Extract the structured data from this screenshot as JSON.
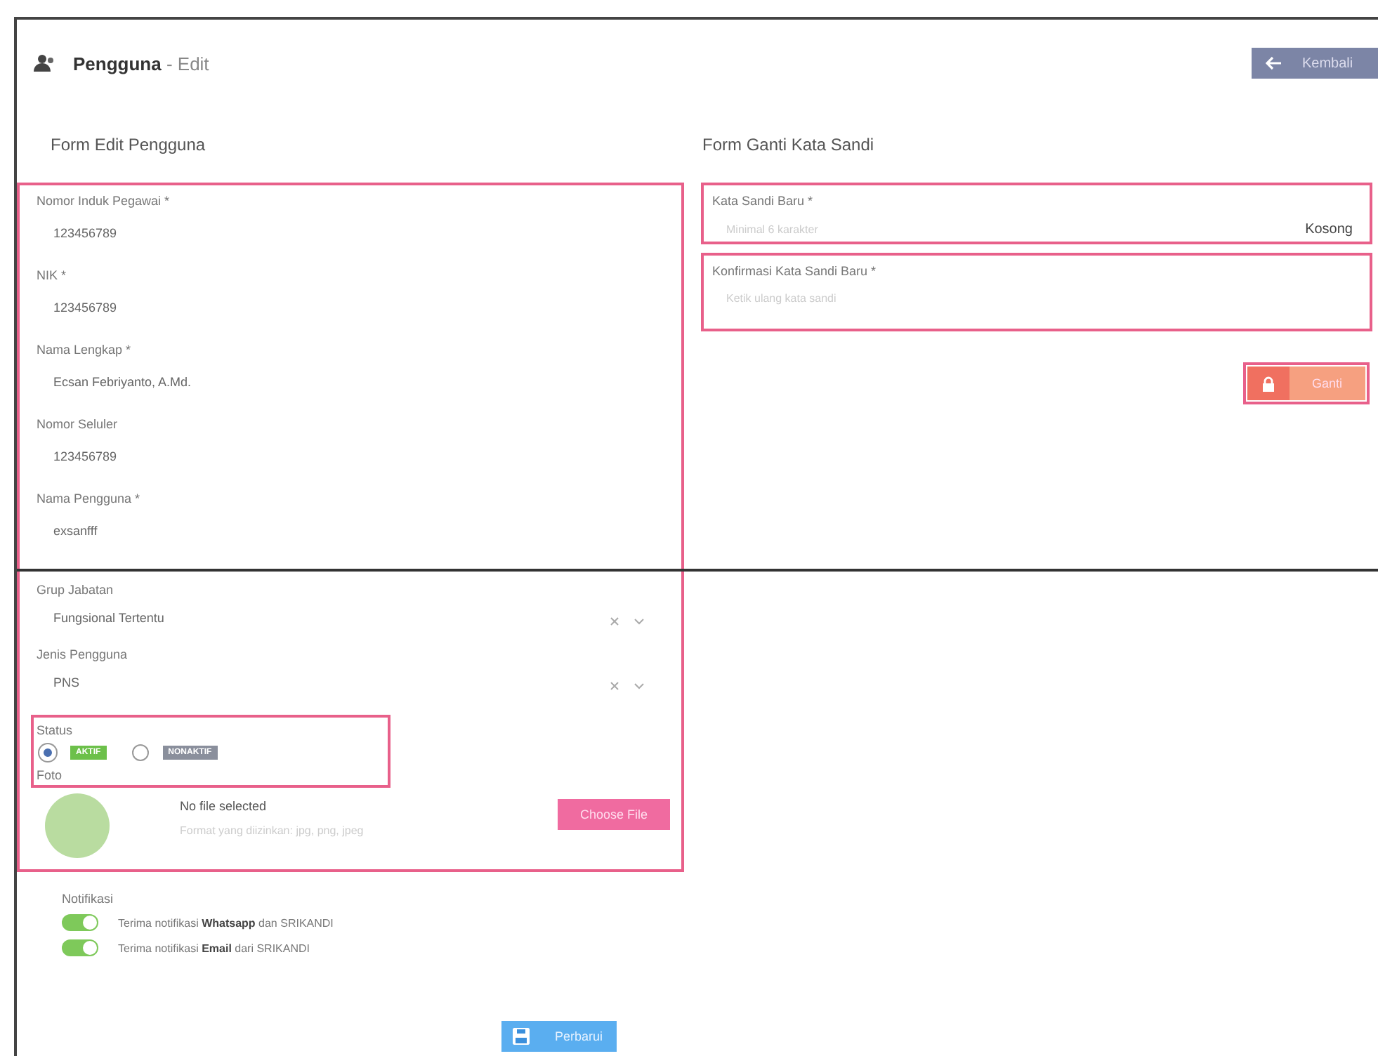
{
  "header": {
    "title": "**Pengguna** - Edit",
    "back_button": "Kembali"
  },
  "edit_form": {
    "title": "Form Edit Pengguna",
    "identity": {
      "highlighted": true,
      "fields": [
        {
          "label": "Nomor Induk Pegawai *",
          "value": "123456789",
          "kind": "text"
        },
        {
          "label": "NIK *",
          "value": "123456789",
          "kind": "text"
        },
        {
          "label": "Nama Lengkap *",
          "value": "Ecsan Febriyanto, A.Md.",
          "kind": "text"
        },
        {
          "label": "Nomor Seluler",
          "value": "123456789",
          "kind": "text"
        },
        {
          "label": "Nama Pengguna *",
          "value": "exsanfff",
          "kind": "text"
        }
      ]
    },
    "details": {
      "highlighted": true,
      "fields": [
        {
          "label": "Grup Jabatan",
          "value": "Fungsional Tertentu",
          "kind": "select"
        },
        {
          "label": "Jenis Pengguna",
          "value": "PNS",
          "kind": "select"
        }
      ],
      "status": {
        "label": "Status",
        "highlighted": true,
        "options": [
          {
            "label": "AKTIF",
            "selected": true,
            "color": "#6cc04a"
          },
          {
            "label": "NONAKTIF",
            "selected": false,
            "color": "#8a8f9c"
          }
        ]
      },
      "photo": {
        "label": "Foto",
        "file_text": "No file selected",
        "hint": "Format yang diizinkan: jpg, png, jpeg",
        "button": "Choose File"
      }
    },
    "notifications": {
      "label": "Notifikasi",
      "items": [
        {
          "text": "Terima notifikasi **Whatsapp** dan SRIKANDI",
          "on": true
        },
        {
          "text": "Terima notifikasi **Email** dari SRIKANDI",
          "on": true
        }
      ]
    },
    "save_button": "Perbarui"
  },
  "password_form": {
    "title": "Form Ganti Kata Sandi",
    "fields": [
      {
        "label": "Kata Sandi Baru *",
        "placeholder": "Minimal 6 karakter",
        "note": "Kosong",
        "highlighted": true
      },
      {
        "label": "Konfirmasi Kata Sandi Baru *",
        "placeholder": "Ketik ulang kata sandi",
        "highlighted": true
      }
    ],
    "button": "Ganti",
    "button_highlighted": true
  }
}
